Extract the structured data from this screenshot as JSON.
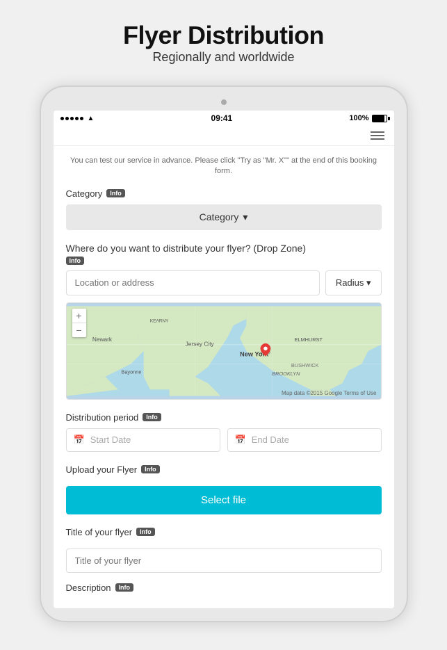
{
  "header": {
    "title": "Flyer Distribution",
    "subtitle": "Regionally and worldwide"
  },
  "statusBar": {
    "time": "09:41",
    "battery": "100%",
    "signalDots": 5
  },
  "infoMessage": "You can test our service in advance. Please click \"Try as \"Mr. X\"\" at the end of this booking form.",
  "category": {
    "sectionLabel": "Category",
    "infoBadge": "Info",
    "dropdownLabel": "Category",
    "dropdownArrow": "▾"
  },
  "dropZone": {
    "sectionLabel": "Where do you want to distribute your flyer? (Drop Zone)",
    "infoBadge": "Info",
    "locationPlaceholder": "Location or address",
    "radiusLabel": "Radius",
    "radiusArrow": "▾",
    "mapAttribution": "Map data ©2015 Google  Terms of Use"
  },
  "distribution": {
    "sectionLabel": "Distribution period",
    "infoBadge": "Info",
    "startPlaceholder": "Start Date",
    "endPlaceholder": "End Date"
  },
  "upload": {
    "sectionLabel": "Upload your Flyer",
    "infoBadge": "Info",
    "buttonLabel": "Select file"
  },
  "flyerTitle": {
    "sectionLabel": "Title of your flyer",
    "infoBadge": "Info",
    "placeholder": "Title of your flyer"
  },
  "description": {
    "sectionLabel": "Description",
    "infoBadge": "Info"
  },
  "hamburger": "≡",
  "zoomPlus": "+",
  "zoomMinus": "−"
}
